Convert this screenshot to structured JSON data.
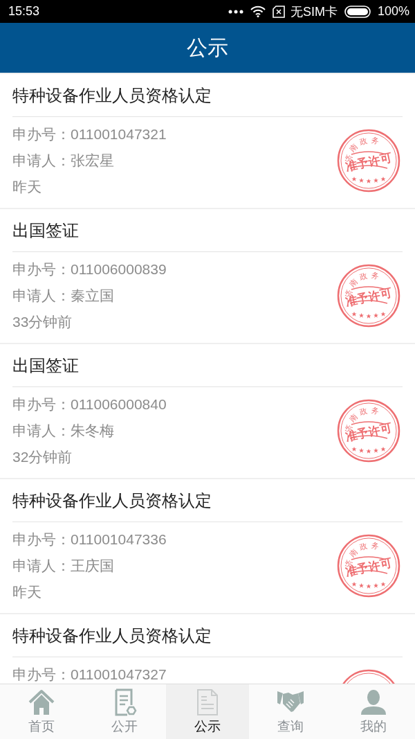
{
  "status_bar": {
    "time": "15:53",
    "carrier": "无SIM卡",
    "battery": "100%"
  },
  "header": {
    "title": "公示"
  },
  "items": [
    {
      "title": "特种设备作业人员资格认定",
      "number_label": "申办号：",
      "number": "011001047321",
      "applicant_label": "申请人：",
      "applicant": "张宏星",
      "time": "昨天",
      "stamp": {
        "arc_text": "济南政务",
        "center_text": "准予许可"
      }
    },
    {
      "title": "出国签证",
      "number_label": "申办号：",
      "number": "011006000839",
      "applicant_label": "申请人：",
      "applicant": "秦立国",
      "time": "33分钟前",
      "stamp": {
        "arc_text": "济南政务",
        "center_text": "准予许可"
      }
    },
    {
      "title": "出国签证",
      "number_label": "申办号：",
      "number": "011006000840",
      "applicant_label": "申请人：",
      "applicant": "朱冬梅",
      "time": "32分钟前",
      "stamp": {
        "arc_text": "济南政务",
        "center_text": "准予许可"
      }
    },
    {
      "title": "特种设备作业人员资格认定",
      "number_label": "申办号：",
      "number": "011001047336",
      "applicant_label": "申请人：",
      "applicant": "王庆国",
      "time": "昨天",
      "stamp": {
        "arc_text": "济南政务",
        "center_text": "准予许可"
      }
    },
    {
      "title": "特种设备作业人员资格认定",
      "number_label": "申办号：",
      "number": "011001047327",
      "stamp": {
        "kind": "stamp"
      }
    }
  ],
  "tabs": [
    {
      "label": "首页",
      "kind": "home",
      "selected": false
    },
    {
      "label": "公开",
      "kind": "form",
      "selected": false
    },
    {
      "label": "公示",
      "kind": "notice",
      "selected": true
    },
    {
      "label": "查询",
      "kind": "query",
      "selected": false
    },
    {
      "label": "我的",
      "kind": "profile",
      "selected": false
    }
  ]
}
